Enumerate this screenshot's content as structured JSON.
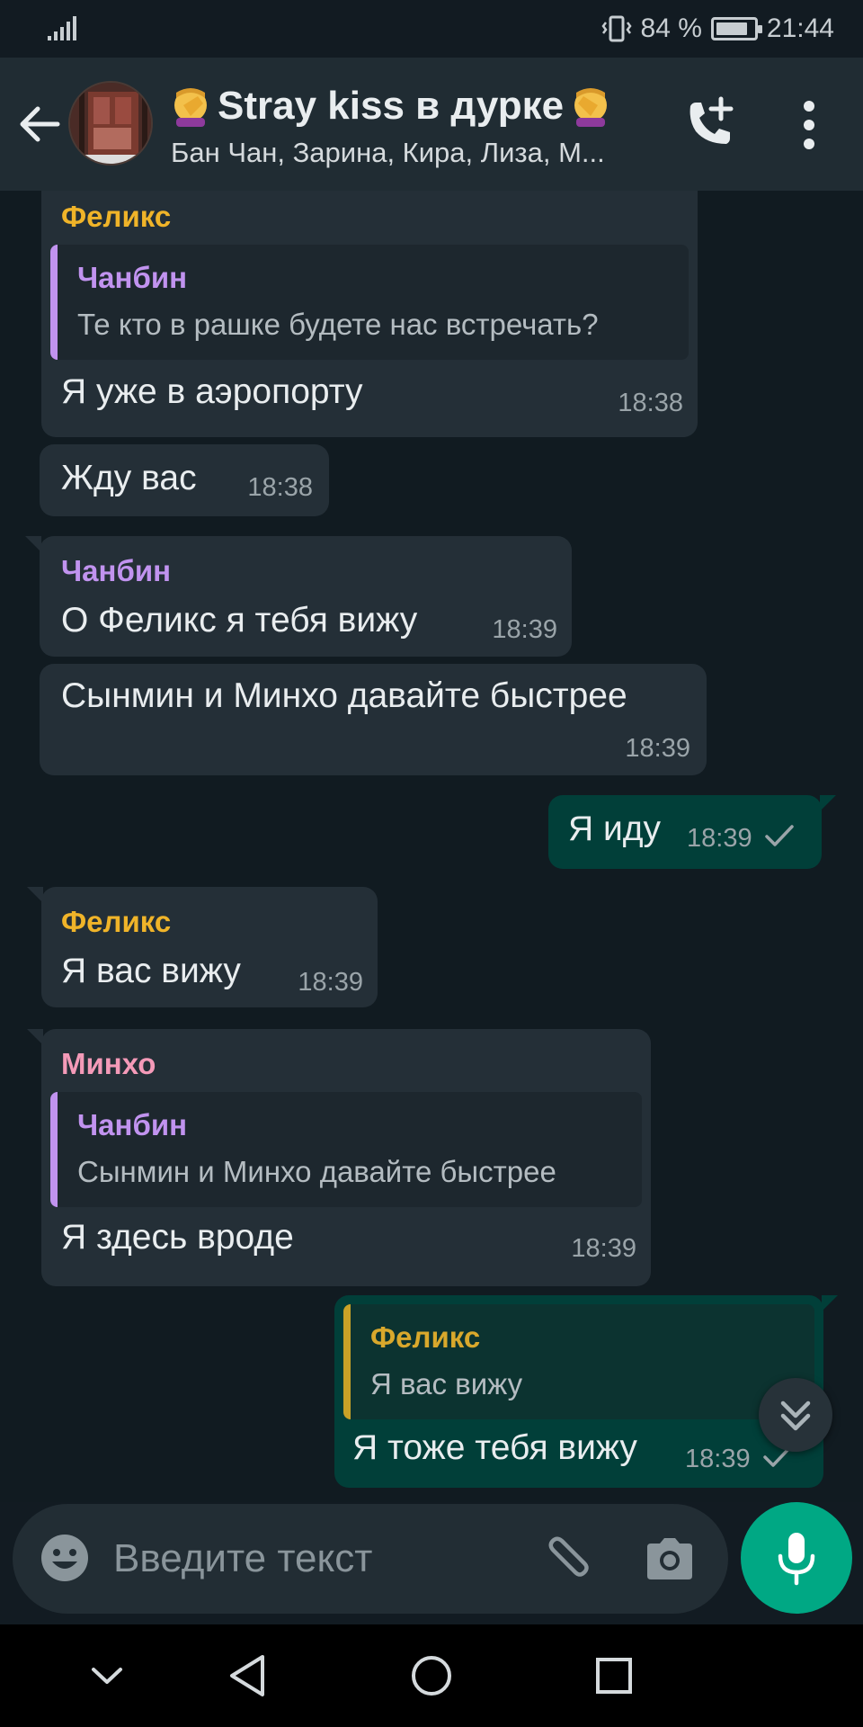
{
  "status_bar": {
    "battery_text": "84 %",
    "battery_level": 0.84,
    "time": "21:44"
  },
  "header": {
    "title": "Stray kiss в дурке",
    "subtitle": "Бан Чан, Зарина, Кира, Лиза, М...",
    "title_emoji_icon": "facepalm-emoji-icon"
  },
  "colors": {
    "header_bg": "#202c33",
    "chat_bg": "#111b21",
    "incoming_bubble": "#242f37",
    "outgoing_bubble": "#013f39",
    "accent_green": "#00a884",
    "sender_felix": "#f0b429",
    "sender_changbin": "#c193ef",
    "sender_minho": "#f49ab8"
  },
  "messages": [
    {
      "sender": "Феликс",
      "quote_name": "Чанбин",
      "quote_text": "Те кто в рашке будете нас встречать?",
      "text": "Я уже в аэропорту",
      "time": "18:38"
    },
    {
      "text": "Жду вас",
      "time": "18:38"
    },
    {
      "sender": "Чанбин",
      "text": "О Феликс я тебя вижу",
      "time": "18:39"
    },
    {
      "text": "Сынмин и Минхо давайте быстрее",
      "time": "18:39"
    },
    {
      "text": "Я иду",
      "time": "18:39",
      "outgoing": true
    },
    {
      "sender": "Феликс",
      "text": "Я вас вижу",
      "time": "18:39"
    },
    {
      "sender": "Минхо",
      "quote_name": "Чанбин",
      "quote_text": "Сынмин и Минхо давайте быстрее",
      "text": "Я здесь вроде",
      "time": "18:39"
    },
    {
      "quote_name": "Феликс",
      "quote_text": "Я вас вижу",
      "text": "Я тоже тебя вижу",
      "time": "18:39",
      "outgoing": true
    }
  ],
  "composer": {
    "placeholder": "Введите текст"
  }
}
